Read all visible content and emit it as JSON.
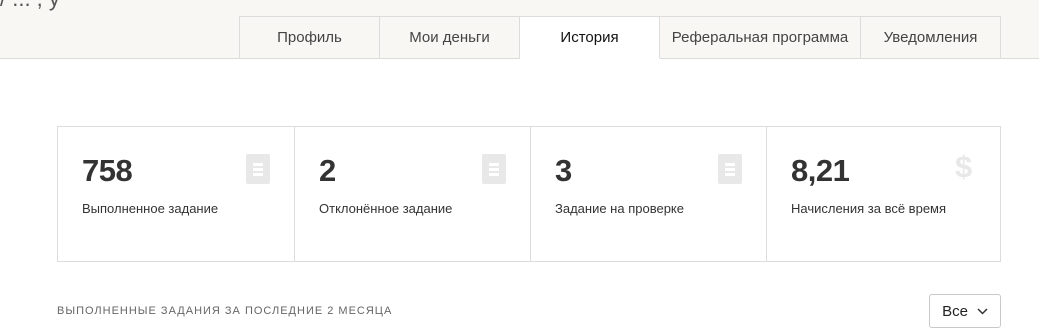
{
  "header": {
    "clipped_title": "/ ... , у"
  },
  "tabs": [
    {
      "label": "Профиль",
      "active": false
    },
    {
      "label": "Мои деньги",
      "active": false
    },
    {
      "label": "История",
      "active": true
    },
    {
      "label": "Реферальная программа",
      "active": false
    },
    {
      "label": "Уведомления",
      "active": false
    }
  ],
  "stats": [
    {
      "value": "758",
      "label": "Выполненное задание",
      "icon": "document-icon"
    },
    {
      "value": "2",
      "label": "Отклонённое задание",
      "icon": "document-icon"
    },
    {
      "value": "3",
      "label": "Задание на проверке",
      "icon": "document-icon"
    },
    {
      "value": "8,21",
      "label": "Начисления за всё время",
      "icon": "dollar-icon",
      "icon_glyph": "$"
    }
  ],
  "history": {
    "title": "ВЫПОЛНЕННЫЕ ЗАДАНИЯ ЗА ПОСЛЕДНИЕ 2 МЕСЯЦА",
    "filter_value": "Все"
  },
  "colors": {
    "band_bg": "#f8f7f4",
    "border": "#dcdcdc",
    "icon_gray": "#e8e8e8",
    "text": "#333333"
  }
}
